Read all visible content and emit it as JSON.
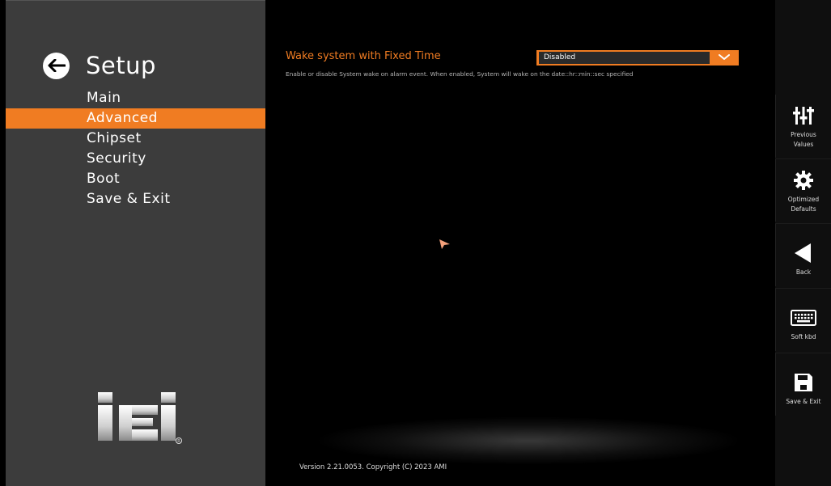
{
  "sidebar": {
    "title": "Setup",
    "menu": [
      {
        "label": "Main",
        "active": false
      },
      {
        "label": "Advanced",
        "active": true
      },
      {
        "label": "Chipset",
        "active": false
      },
      {
        "label": "Security",
        "active": false
      },
      {
        "label": "Boot",
        "active": false
      },
      {
        "label": "Save & Exit",
        "active": false
      }
    ],
    "logo_text": "iEi"
  },
  "main": {
    "option_label": "Wake system with Fixed Time",
    "dropdown_value": "Disabled",
    "help_text": "Enable or disable System wake on alarm event. When enabled, System will wake on the date::hr::min::sec specified",
    "version": "Version 2.21.0053. Copyright (C) 2023 AMI"
  },
  "right_panel": {
    "previous_values": {
      "line1": "Previous",
      "line2": "Values",
      "icon": "sliders-icon"
    },
    "optimized_defaults": {
      "line1": "Optimized",
      "line2": "Defaults",
      "icon": "gear-icon"
    },
    "back": {
      "label": "Back",
      "icon": "back-triangle-icon"
    },
    "soft_kbd": {
      "label": "Soft kbd",
      "icon": "keyboard-icon"
    },
    "save_exit": {
      "label": "Save & Exit",
      "icon": "floppy-icon"
    }
  },
  "colors": {
    "accent": "#f07c22",
    "sidebar_bg": "#3c3c3c",
    "main_bg": "#000000"
  }
}
